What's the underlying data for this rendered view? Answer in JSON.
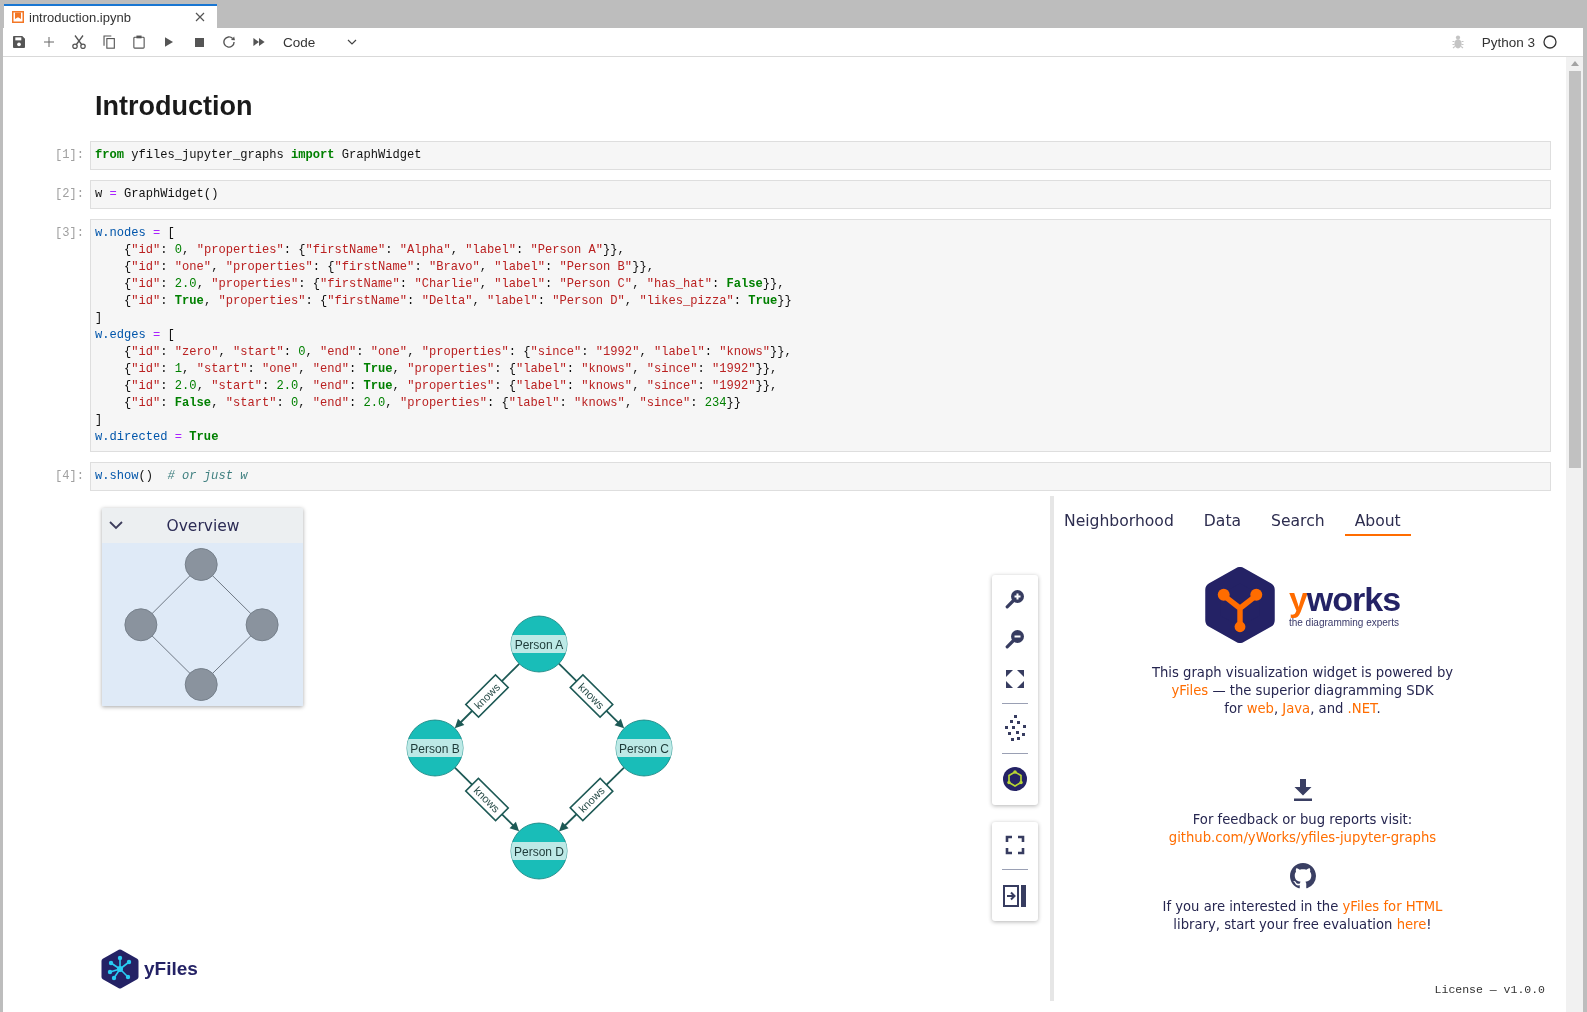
{
  "tab_bar": {
    "tabs": [
      {
        "title": "introduction.ipynb",
        "selected": true
      }
    ]
  },
  "toolbar": {
    "cell_type": "Code",
    "kernel": {
      "name": "Python 3",
      "busy": false
    }
  },
  "notebook": {
    "heading": "Introduction",
    "cells": [
      {
        "prompt": "[1]:",
        "lines": [
          [
            {
              "kind": "kw",
              "text": "from"
            },
            {
              "kind": "text",
              "text": " yfiles_jupyter_graphs "
            },
            {
              "kind": "kw",
              "text": "import"
            },
            {
              "kind": "text",
              "text": " GraphWidget"
            }
          ]
        ]
      },
      {
        "prompt": "[2]:",
        "lines": [
          [
            {
              "kind": "text",
              "text": "w "
            },
            {
              "kind": "op",
              "text": "="
            },
            {
              "kind": "text",
              "text": " GraphWidget()"
            }
          ]
        ]
      },
      {
        "prompt": "[3]:",
        "lines": [
          [
            {
              "kind": "prop",
              "text": "w.nodes "
            },
            {
              "kind": "op",
              "text": "="
            },
            {
              "kind": "text",
              "text": " ["
            }
          ],
          [
            {
              "kind": "text",
              "text": "    {"
            },
            {
              "kind": "str",
              "text": "\"id\""
            },
            {
              "kind": "text",
              "text": ": "
            },
            {
              "kind": "num",
              "text": "0"
            },
            {
              "kind": "text",
              "text": ", "
            },
            {
              "kind": "str",
              "text": "\"properties\""
            },
            {
              "kind": "text",
              "text": ": {"
            },
            {
              "kind": "str",
              "text": "\"firstName\""
            },
            {
              "kind": "text",
              "text": ": "
            },
            {
              "kind": "str",
              "text": "\"Alpha\""
            },
            {
              "kind": "text",
              "text": ", "
            },
            {
              "kind": "str",
              "text": "\"label\""
            },
            {
              "kind": "text",
              "text": ": "
            },
            {
              "kind": "str",
              "text": "\"Person A\""
            },
            {
              "kind": "text",
              "text": "}},"
            }
          ],
          [
            {
              "kind": "text",
              "text": "    {"
            },
            {
              "kind": "str",
              "text": "\"id\""
            },
            {
              "kind": "text",
              "text": ": "
            },
            {
              "kind": "str",
              "text": "\"one\""
            },
            {
              "kind": "text",
              "text": ", "
            },
            {
              "kind": "str",
              "text": "\"properties\""
            },
            {
              "kind": "text",
              "text": ": {"
            },
            {
              "kind": "str",
              "text": "\"firstName\""
            },
            {
              "kind": "text",
              "text": ": "
            },
            {
              "kind": "str",
              "text": "\"Bravo\""
            },
            {
              "kind": "text",
              "text": ", "
            },
            {
              "kind": "str",
              "text": "\"label\""
            },
            {
              "kind": "text",
              "text": ": "
            },
            {
              "kind": "str",
              "text": "\"Person B\""
            },
            {
              "kind": "text",
              "text": "}},"
            }
          ],
          [
            {
              "kind": "text",
              "text": "    {"
            },
            {
              "kind": "str",
              "text": "\"id\""
            },
            {
              "kind": "text",
              "text": ": "
            },
            {
              "kind": "num",
              "text": "2.0"
            },
            {
              "kind": "text",
              "text": ", "
            },
            {
              "kind": "str",
              "text": "\"properties\""
            },
            {
              "kind": "text",
              "text": ": {"
            },
            {
              "kind": "str",
              "text": "\"firstName\""
            },
            {
              "kind": "text",
              "text": ": "
            },
            {
              "kind": "str",
              "text": "\"Charlie\""
            },
            {
              "kind": "text",
              "text": ", "
            },
            {
              "kind": "str",
              "text": "\"label\""
            },
            {
              "kind": "text",
              "text": ": "
            },
            {
              "kind": "str",
              "text": "\"Person C\""
            },
            {
              "kind": "text",
              "text": ", "
            },
            {
              "kind": "str",
              "text": "\"has_hat\""
            },
            {
              "kind": "text",
              "text": ": "
            },
            {
              "kind": "kw",
              "text": "False"
            },
            {
              "kind": "text",
              "text": "}},"
            }
          ],
          [
            {
              "kind": "text",
              "text": "    {"
            },
            {
              "kind": "str",
              "text": "\"id\""
            },
            {
              "kind": "text",
              "text": ": "
            },
            {
              "kind": "kw",
              "text": "True"
            },
            {
              "kind": "text",
              "text": ", "
            },
            {
              "kind": "str",
              "text": "\"properties\""
            },
            {
              "kind": "text",
              "text": ": {"
            },
            {
              "kind": "str",
              "text": "\"firstName\""
            },
            {
              "kind": "text",
              "text": ": "
            },
            {
              "kind": "str",
              "text": "\"Delta\""
            },
            {
              "kind": "text",
              "text": ", "
            },
            {
              "kind": "str",
              "text": "\"label\""
            },
            {
              "kind": "text",
              "text": ": "
            },
            {
              "kind": "str",
              "text": "\"Person D\""
            },
            {
              "kind": "text",
              "text": ", "
            },
            {
              "kind": "str",
              "text": "\"likes_pizza\""
            },
            {
              "kind": "text",
              "text": ": "
            },
            {
              "kind": "kw",
              "text": "True"
            },
            {
              "kind": "text",
              "text": "}}"
            }
          ],
          [
            {
              "kind": "text",
              "text": "]"
            }
          ],
          [
            {
              "kind": "prop",
              "text": "w.edges "
            },
            {
              "kind": "op",
              "text": "="
            },
            {
              "kind": "text",
              "text": " ["
            }
          ],
          [
            {
              "kind": "text",
              "text": "    {"
            },
            {
              "kind": "str",
              "text": "\"id\""
            },
            {
              "kind": "text",
              "text": ": "
            },
            {
              "kind": "str",
              "text": "\"zero\""
            },
            {
              "kind": "text",
              "text": ", "
            },
            {
              "kind": "str",
              "text": "\"start\""
            },
            {
              "kind": "text",
              "text": ": "
            },
            {
              "kind": "num",
              "text": "0"
            },
            {
              "kind": "text",
              "text": ", "
            },
            {
              "kind": "str",
              "text": "\"end\""
            },
            {
              "kind": "text",
              "text": ": "
            },
            {
              "kind": "str",
              "text": "\"one\""
            },
            {
              "kind": "text",
              "text": ", "
            },
            {
              "kind": "str",
              "text": "\"properties\""
            },
            {
              "kind": "text",
              "text": ": {"
            },
            {
              "kind": "str",
              "text": "\"since\""
            },
            {
              "kind": "text",
              "text": ": "
            },
            {
              "kind": "str",
              "text": "\"1992\""
            },
            {
              "kind": "text",
              "text": ", "
            },
            {
              "kind": "str",
              "text": "\"label\""
            },
            {
              "kind": "text",
              "text": ": "
            },
            {
              "kind": "str",
              "text": "\"knows\""
            },
            {
              "kind": "text",
              "text": "}},"
            }
          ],
          [
            {
              "kind": "text",
              "text": "    {"
            },
            {
              "kind": "str",
              "text": "\"id\""
            },
            {
              "kind": "text",
              "text": ": "
            },
            {
              "kind": "num",
              "text": "1"
            },
            {
              "kind": "text",
              "text": ", "
            },
            {
              "kind": "str",
              "text": "\"start\""
            },
            {
              "kind": "text",
              "text": ": "
            },
            {
              "kind": "str",
              "text": "\"one\""
            },
            {
              "kind": "text",
              "text": ", "
            },
            {
              "kind": "str",
              "text": "\"end\""
            },
            {
              "kind": "text",
              "text": ": "
            },
            {
              "kind": "kw",
              "text": "True"
            },
            {
              "kind": "text",
              "text": ", "
            },
            {
              "kind": "str",
              "text": "\"properties\""
            },
            {
              "kind": "text",
              "text": ": {"
            },
            {
              "kind": "str",
              "text": "\"label\""
            },
            {
              "kind": "text",
              "text": ": "
            },
            {
              "kind": "str",
              "text": "\"knows\""
            },
            {
              "kind": "text",
              "text": ", "
            },
            {
              "kind": "str",
              "text": "\"since\""
            },
            {
              "kind": "text",
              "text": ": "
            },
            {
              "kind": "str",
              "text": "\"1992\""
            },
            {
              "kind": "text",
              "text": "}},"
            }
          ],
          [
            {
              "kind": "text",
              "text": "    {"
            },
            {
              "kind": "str",
              "text": "\"id\""
            },
            {
              "kind": "text",
              "text": ": "
            },
            {
              "kind": "num",
              "text": "2.0"
            },
            {
              "kind": "text",
              "text": ", "
            },
            {
              "kind": "str",
              "text": "\"start\""
            },
            {
              "kind": "text",
              "text": ": "
            },
            {
              "kind": "num",
              "text": "2.0"
            },
            {
              "kind": "text",
              "text": ", "
            },
            {
              "kind": "str",
              "text": "\"end\""
            },
            {
              "kind": "text",
              "text": ": "
            },
            {
              "kind": "kw",
              "text": "True"
            },
            {
              "kind": "text",
              "text": ", "
            },
            {
              "kind": "str",
              "text": "\"properties\""
            },
            {
              "kind": "text",
              "text": ": {"
            },
            {
              "kind": "str",
              "text": "\"label\""
            },
            {
              "kind": "text",
              "text": ": "
            },
            {
              "kind": "str",
              "text": "\"knows\""
            },
            {
              "kind": "text",
              "text": ", "
            },
            {
              "kind": "str",
              "text": "\"since\""
            },
            {
              "kind": "text",
              "text": ": "
            },
            {
              "kind": "str",
              "text": "\"1992\""
            },
            {
              "kind": "text",
              "text": "}},"
            }
          ],
          [
            {
              "kind": "text",
              "text": "    {"
            },
            {
              "kind": "str",
              "text": "\"id\""
            },
            {
              "kind": "text",
              "text": ": "
            },
            {
              "kind": "kw",
              "text": "False"
            },
            {
              "kind": "text",
              "text": ", "
            },
            {
              "kind": "str",
              "text": "\"start\""
            },
            {
              "kind": "text",
              "text": ": "
            },
            {
              "kind": "num",
              "text": "0"
            },
            {
              "kind": "text",
              "text": ", "
            },
            {
              "kind": "str",
              "text": "\"end\""
            },
            {
              "kind": "text",
              "text": ": "
            },
            {
              "kind": "num",
              "text": "2.0"
            },
            {
              "kind": "text",
              "text": ", "
            },
            {
              "kind": "str",
              "text": "\"properties\""
            },
            {
              "kind": "text",
              "text": ": {"
            },
            {
              "kind": "str",
              "text": "\"label\""
            },
            {
              "kind": "text",
              "text": ": "
            },
            {
              "kind": "str",
              "text": "\"knows\""
            },
            {
              "kind": "text",
              "text": ", "
            },
            {
              "kind": "str",
              "text": "\"since\""
            },
            {
              "kind": "text",
              "text": ": "
            },
            {
              "kind": "num",
              "text": "234"
            },
            {
              "kind": "text",
              "text": "}}"
            }
          ],
          [
            {
              "kind": "text",
              "text": "]"
            }
          ],
          [
            {
              "kind": "prop",
              "text": "w.directed "
            },
            {
              "kind": "op",
              "text": "= "
            },
            {
              "kind": "kw",
              "text": "True"
            }
          ]
        ]
      },
      {
        "prompt": "[4]:",
        "lines": [
          [
            {
              "kind": "prop",
              "text": "w.show"
            },
            {
              "kind": "text",
              "text": "()  "
            },
            {
              "kind": "comment",
              "text": "# or just w"
            }
          ]
        ]
      }
    ]
  },
  "widget": {
    "overview": {
      "title": "Overview",
      "expanded": true
    },
    "nodes": [
      {
        "label": "Person A"
      },
      {
        "label": "Person B"
      },
      {
        "label": "Person C"
      },
      {
        "label": "Person D"
      }
    ],
    "edges": [
      {
        "label": "knows"
      },
      {
        "label": "knows"
      },
      {
        "label": "knows"
      },
      {
        "label": "knows"
      }
    ],
    "directed": true,
    "brand": "yFiles",
    "side_panel": {
      "tabs": [
        {
          "label": "Neighborhood",
          "selected": false
        },
        {
          "label": "Data",
          "selected": false
        },
        {
          "label": "Search",
          "selected": false
        },
        {
          "label": "About",
          "selected": true
        }
      ],
      "about": {
        "logo": {
          "wordmark": [
            {
              "kind": "accent",
              "text": "y"
            },
            {
              "kind": "plain",
              "text": "works"
            }
          ],
          "tagline": "the diagramming experts"
        },
        "intro": [
          {
            "kind": "text",
            "text": "This graph visualization widget is powered by\n"
          },
          {
            "kind": "link",
            "text": "yFiles"
          },
          {
            "kind": "text",
            "text": " — the superior diagramming SDK\nfor "
          },
          {
            "kind": "link",
            "text": "web"
          },
          {
            "kind": "text",
            "text": ", "
          },
          {
            "kind": "link",
            "text": "Java"
          },
          {
            "kind": "text",
            "text": ", and "
          },
          {
            "kind": "link",
            "text": ".NET"
          },
          {
            "kind": "text",
            "text": "."
          }
        ],
        "feedback": [
          {
            "kind": "text",
            "text": "For feedback or bug reports visit:\n"
          },
          {
            "kind": "link",
            "text": "github.com/yWorks/yfiles-jupyter-graphs"
          }
        ],
        "evaluation": [
          {
            "kind": "text",
            "text": "If you are interested in the "
          },
          {
            "kind": "link",
            "text": "yFiles for HTML"
          },
          {
            "kind": "text",
            "text": "\nlibrary, start your free evaluation "
          },
          {
            "kind": "link",
            "text": "here"
          },
          {
            "kind": "text",
            "text": "!"
          }
        ],
        "license": "License — v1.0.0"
      }
    }
  }
}
